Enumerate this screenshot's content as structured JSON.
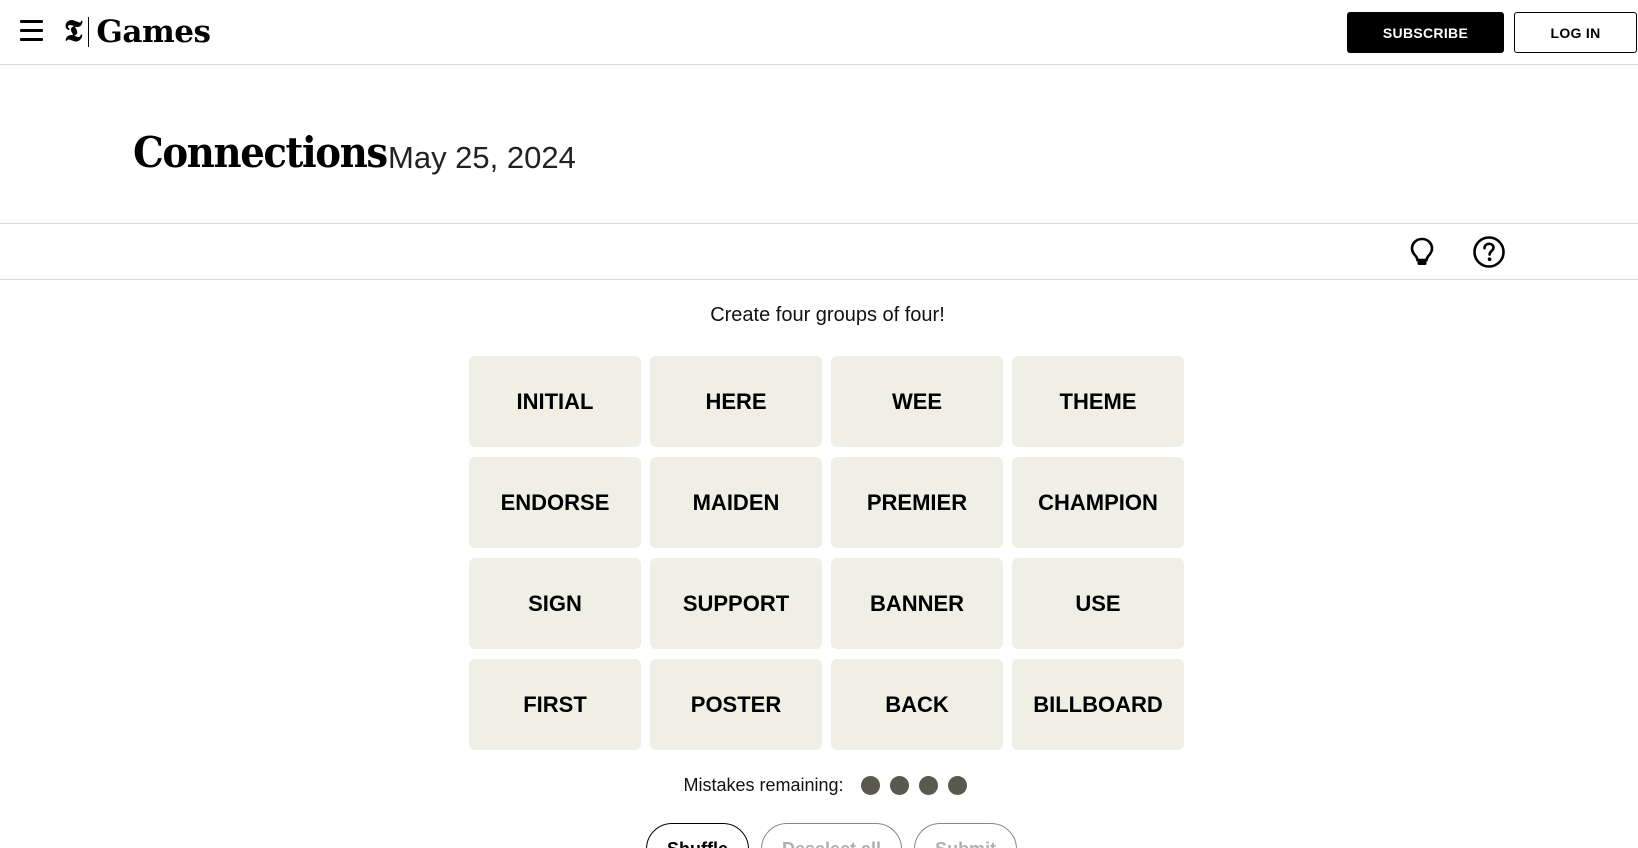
{
  "topbar": {
    "logo_mark": "𝕿",
    "logo_text": "Games",
    "subscribe_label": "SUBSCRIBE",
    "login_label": "LOG IN"
  },
  "header": {
    "title": "Connections",
    "date": "May 25, 2024"
  },
  "toolbar": {
    "icons": [
      "lightbulb-icon",
      "help-icon"
    ]
  },
  "game": {
    "prompt": "Create four groups of four!",
    "tiles": [
      "INITIAL",
      "HERE",
      "WEE",
      "THEME",
      "ENDORSE",
      "MAIDEN",
      "PREMIER",
      "CHAMPION",
      "SIGN",
      "SUPPORT",
      "BANNER",
      "USE",
      "FIRST",
      "POSTER",
      "BACK",
      "BILLBOARD"
    ],
    "mistakes_label": "Mistakes remaining:",
    "mistakes_remaining": 4,
    "buttons": {
      "shuffle": "Shuffle",
      "deselect": "Deselect all",
      "submit": "Submit"
    }
  },
  "colors": {
    "tile_bg": "#efefe6",
    "dot": "#5a594e"
  }
}
